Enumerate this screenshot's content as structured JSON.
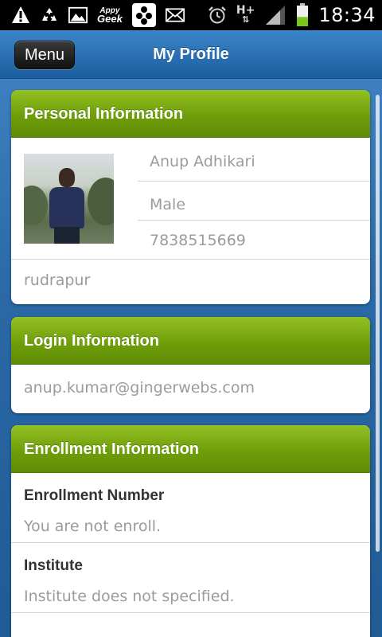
{
  "status_bar": {
    "time": "18:34",
    "appy_top": "Appy",
    "appy_bottom": "Geek",
    "network": "H+",
    "icons": [
      "warning-icon",
      "recycle-icon",
      "image-icon",
      "appy-geek-icon",
      "chat-icon",
      "mail-icon",
      "alarm-icon",
      "network-h-plus-icon",
      "signal-icon",
      "battery-icon"
    ],
    "battery_level": 0.45
  },
  "header": {
    "menu_label": "Menu",
    "title": "My Profile"
  },
  "personal": {
    "heading": "Personal Information",
    "name": "Anup Adhikari",
    "gender": "Male",
    "phone": "7838515669",
    "city": "rudrapur"
  },
  "login": {
    "heading": "Login Information",
    "email": "anup.kumar@gingerwebs.com"
  },
  "enrollment": {
    "heading": "Enrollment Information",
    "fields": [
      {
        "label": "Enrollment Number",
        "value": "You are not enroll."
      },
      {
        "label": "Institute",
        "value": "Institute does not specified."
      }
    ]
  },
  "colors": {
    "header_blue": "#2a6fb0",
    "card_head_green": "#6f9e0a",
    "muted_text": "#9b9b9b",
    "battery_green": "#7bc61c"
  }
}
